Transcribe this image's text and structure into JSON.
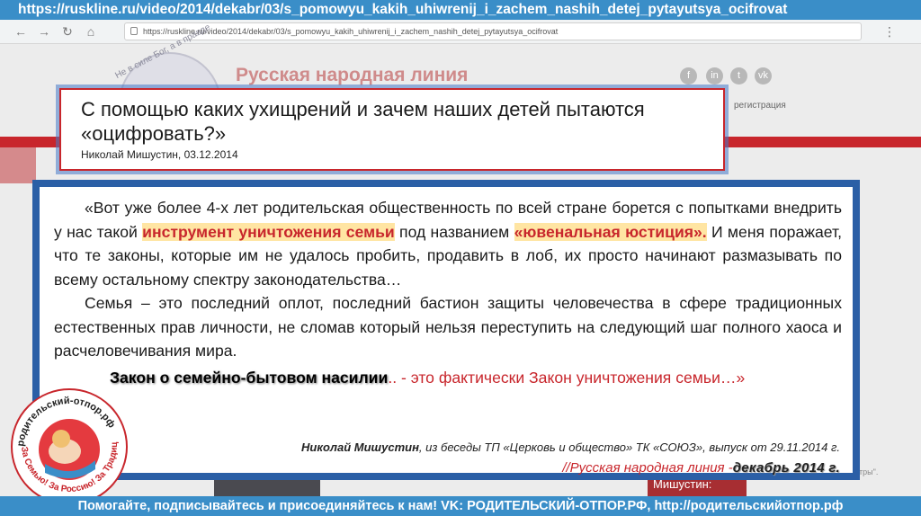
{
  "top_banner": {
    "url_text": "https://ruskline.ru/video/2014/dekabr/03/s_pomowyu_kakih_uhiwrenij_i_zachem_nashih_detej_pytayutsya_ocifrovat"
  },
  "browser": {
    "address": "https://ruskline.ru/video/2014/dekabr/03/s_pomowyu_kakih_uhiwrenij_i_zachem_nashih_detej_pytayutsya_ocifrovat"
  },
  "site": {
    "logo_arc": "Не в силе Бог, а в правде",
    "name": "Русская народная линия",
    "register_label": "регистрация",
    "social_icons": [
      "f",
      "in",
      "t",
      "vk"
    ],
    "presenter_label": "Мишустин:",
    "right_fragment": "итры\"."
  },
  "headline": {
    "title": "С помощью каких ухищрений и зачем наших детей пытаются «оцифровать?»",
    "byline": "Николай Мишустин, 03.12.2014"
  },
  "quote": {
    "p1_a": "«Вот уже более 4-х лет родительская общественность по всей стране борется с попытками внедрить у нас такой ",
    "p1_hl1": "инструмент уничтожения семьи",
    "p1_b": " под названием ",
    "p1_hl2": "«ювенальная юстиция».",
    "p1_c": " И меня поражает, что те законы, которые им не удалось пробить, продавить в лоб, их просто начинают размазывать по всему остальному спектру законодательства…",
    "p2": "Семья – это последний оплот, последний бастион защиты человечества в сфере традиционных естественных прав личности, не сломав который нельзя переступить на следующий шаг полного хаоса и расчеловечивания мира.",
    "law_a": "Закон о семейно-бытовом насилии",
    "law_b": ".. - ",
    "law_c": "это фактически Закон уничтожения семьи…»",
    "attr_name": "Николай Мишустин",
    "attr_rest": ", из беседы ТП «Церковь и общество» ТК «СОЮЗ», выпуск от 29.11.2014 г.",
    "source_a": "//Русская народная линия -",
    "source_b": "декабрь 2014 г."
  },
  "emblem": {
    "top_text": "родительский-отпор.рф",
    "bottom_text": "За Семью! За Россию! За Традиции!"
  },
  "bottom_bar": {
    "text": "Помогайте, подписывайтесь и присоединяйтесь к нам! VK: РОДИТЕЛЬСКИЙ-ОТПОР.РФ, http://родительскийотпор.рф"
  },
  "colors": {
    "banner_blue": "#3a8ec8",
    "accent_red": "#c8262c",
    "frame_blue": "#2b5fa6",
    "highlight": "#ffe5a3"
  }
}
